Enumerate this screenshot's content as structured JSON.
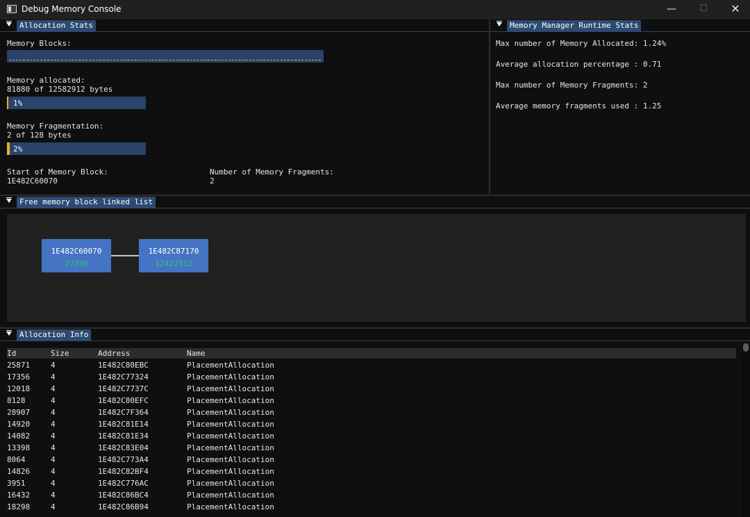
{
  "window": {
    "title": "Debug Memory Console",
    "minimize": "—",
    "maximize": "☐",
    "close": "✕"
  },
  "alloc_stats": {
    "tab": "Allocation Stats",
    "memory_blocks_label": "Memory Blocks:",
    "memory_allocated_label": "Memory allocated:",
    "memory_allocated_value": "81880 of 12582912 bytes",
    "memory_allocated_progress": "1%",
    "memory_allocated_fraction": 0.01,
    "fragmentation_label": "Memory Fragmentation:",
    "fragmentation_value": "2 of 128 bytes",
    "fragmentation_progress": "2%",
    "fragmentation_fraction": 0.02,
    "start_label": "Start of Memory Block:",
    "start_value": "1E482C60070",
    "fragments_label": "Number of Memory Fragments:",
    "fragments_value": "2",
    "accent": "#e6b422"
  },
  "runtime_stats": {
    "tab": "Memory Manager Runtime Stats",
    "lines": [
      "Max number of Memory Allocated: 1.24%",
      "Average allocation percentage : 0.71",
      "Max number of Memory Fragments: 2",
      "Average memory fragments used : 1.25"
    ]
  },
  "linked_list": {
    "tab": "Free memory block linked list",
    "nodes": [
      {
        "address": "1E482C60070",
        "size": "77280"
      },
      {
        "address": "1E482C87170",
        "size": "12422912"
      }
    ]
  },
  "alloc_info": {
    "tab": "Allocation Info",
    "columns": [
      "Id",
      "Size",
      "Address",
      "Name"
    ],
    "rows": [
      [
        "25871",
        "4",
        "1E482C80EBC",
        "PlacementAllocation"
      ],
      [
        "17356",
        "4",
        "1E482C77324",
        "PlacementAllocation"
      ],
      [
        "12018",
        "4",
        "1E482C7737C",
        "PlacementAllocation"
      ],
      [
        "8128",
        "4",
        "1E482C80EFC",
        "PlacementAllocation"
      ],
      [
        "28907",
        "4",
        "1E482C7F364",
        "PlacementAllocation"
      ],
      [
        "14920",
        "4",
        "1E482C81E14",
        "PlacementAllocation"
      ],
      [
        "14082",
        "4",
        "1E482C81E34",
        "PlacementAllocation"
      ],
      [
        "13398",
        "4",
        "1E482C83E04",
        "PlacementAllocation"
      ],
      [
        "8064",
        "4",
        "1E482C773A4",
        "PlacementAllocation"
      ],
      [
        "14826",
        "4",
        "1E482C82BF4",
        "PlacementAllocation"
      ],
      [
        "3951",
        "4",
        "1E482C776AC",
        "PlacementAllocation"
      ],
      [
        "16432",
        "4",
        "1E482C86BC4",
        "PlacementAllocation"
      ],
      [
        "18298",
        "4",
        "1E482C86B94",
        "PlacementAllocation"
      ]
    ]
  }
}
